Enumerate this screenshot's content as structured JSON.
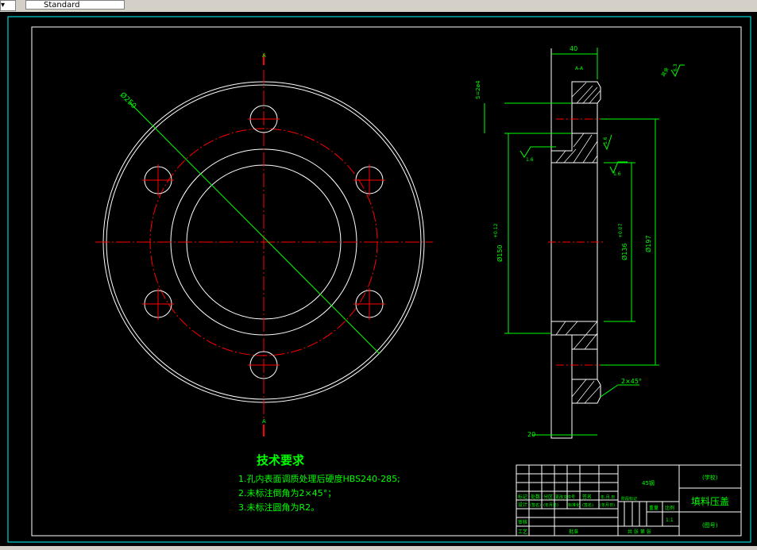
{
  "toolbar": {
    "style_value": "Standard"
  },
  "drawing": {
    "dim_bolt_circle": "Ø250",
    "section_mark_top": "A",
    "section_mark_bottom": "A",
    "dim_width": "40",
    "dim_flange": "20",
    "dim_phi_hole": "Ø150",
    "dim_phi_hole_tol": "+0.12",
    "dim_phi_inner": "Ø136",
    "dim_phi_inner_tol": "+0.07",
    "dim_phi_outer": "Ø197",
    "dim_chamfer": "2×45°",
    "dim_side": "S=2ø4",
    "rough_1": "1.6",
    "rough_2": "1.6",
    "rough_3": "1.6",
    "rough_top": "6.3",
    "rough_other": "其余",
    "section_label": "A-A"
  },
  "notes": {
    "title": "技术要求",
    "line1": "1.孔内表面调质处理后硬度HBS240-285;",
    "line2": "2.未标注倒角为2×45°；",
    "line3": "3.未标注圆角为R2。"
  },
  "titleblock": {
    "material": "45钢",
    "school": "(学校)",
    "part_name": "填料压盖",
    "drawing_no": "(图号)",
    "scale": "1:1",
    "r1_c1": "标记",
    "r1_c2": "处数",
    "r1_c3": "分区",
    "r1_c4": "更改文件号",
    "r1_c5": "签名",
    "r1_c6": "年.月.日",
    "r2_c1": "设计",
    "r2_c2": "(签名)",
    "r2_c3": "(年月日)",
    "r2_c4": "标准化",
    "r2_c5": "(签名)",
    "r2_c6": "(年月日)",
    "stage": "阶段标记",
    "weight": "重量",
    "scale_label": "比例",
    "review": "审核",
    "process": "工艺",
    "approve": "批准",
    "sheets": "共 张 第 张"
  }
}
